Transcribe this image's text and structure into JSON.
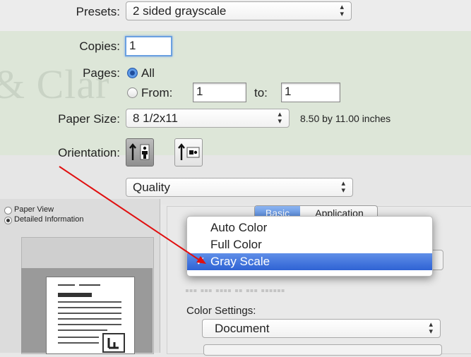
{
  "presets": {
    "label": "Presets:",
    "value": "2 sided grayscale"
  },
  "copies": {
    "label": "Copies:",
    "value": "1"
  },
  "pages": {
    "label": "Pages:",
    "all_label": "All",
    "from_label": "From:",
    "from_value": "1",
    "to_label": "to:",
    "to_value": "1"
  },
  "paper_size": {
    "label": "Paper Size:",
    "value": "8 1/2x11",
    "note": "8.50 by 11.00 inches"
  },
  "orientation": {
    "label": "Orientation:",
    "selected": "portrait"
  },
  "section_popup": {
    "value": "Quality"
  },
  "preview_options": {
    "paper_view": "Paper View",
    "detailed_info": "Detailed Information"
  },
  "tabs": {
    "basic": "Basic",
    "application": "Application"
  },
  "color_menu": {
    "items": [
      "Auto Color",
      "Full Color",
      "Gray Scale"
    ],
    "selected": "Gray Scale",
    "checkmark": "✓"
  },
  "color_settings": {
    "label": "Color Settings:",
    "value": "Document"
  },
  "colors": {
    "accent": "#2f63d4",
    "annotation_arrow": "#e01010"
  }
}
